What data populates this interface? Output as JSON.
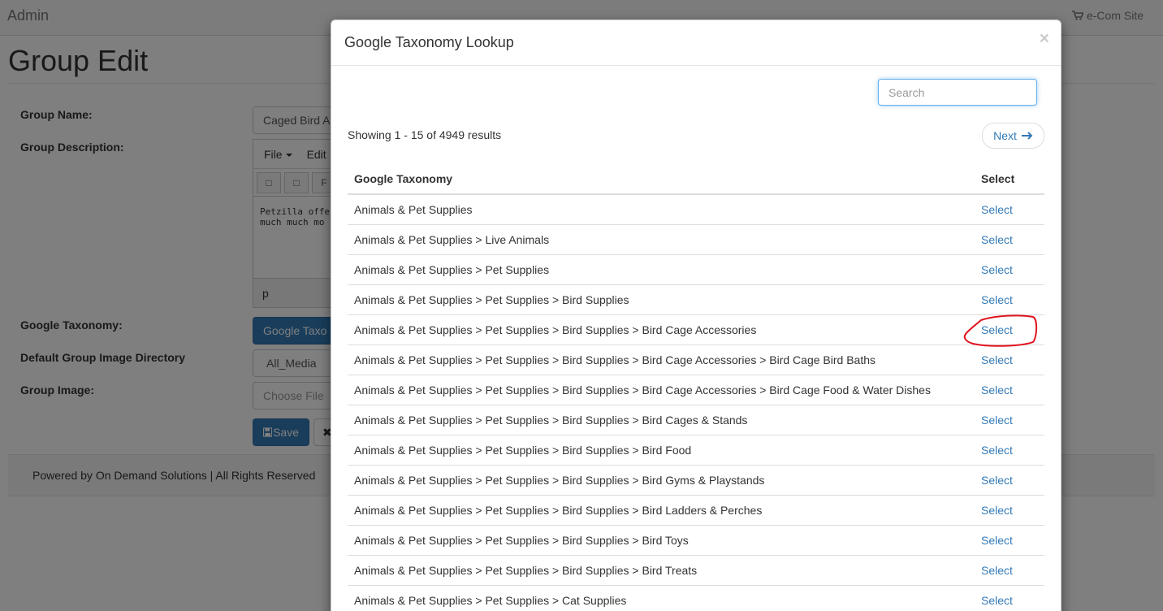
{
  "navbar": {
    "brand": "Admin",
    "ecom_link": "e-Com Site",
    "ecom_icon": "shopping-cart-icon"
  },
  "page": {
    "title": "Group Edit"
  },
  "form": {
    "group_name_label": "Group Name:",
    "group_name_value": "Caged Bird A",
    "group_description_label": "Group Description:",
    "editor": {
      "menu_file": "File",
      "menu_edit": "Edit",
      "toolbar_partial": "F",
      "body_text": "Petzilla offers a\nmuch much mo",
      "status_path": "p"
    },
    "google_taxonomy_label": "Google Taxonomy:",
    "google_taxonomy_button": "Google Taxo",
    "default_image_dir_label": "Default Group Image Directory",
    "default_image_dir_value": "All_Media",
    "group_image_label": "Group Image:",
    "choose_file_label": "Choose File",
    "save_label": "Save",
    "cancel_partial": "✖"
  },
  "footer": {
    "text": "Powered by On Demand Solutions | All Rights Reserved"
  },
  "modal": {
    "title": "Google Taxonomy Lookup",
    "close_symbol": "×",
    "search_placeholder": "Search",
    "results_text": "Showing 1 - 15 of 4949 results",
    "next_label": "Next",
    "table": {
      "col_taxonomy": "Google Taxonomy",
      "col_select": "Select",
      "rows": [
        {
          "taxonomy": "Animals & Pet Supplies",
          "action": "Select"
        },
        {
          "taxonomy": "Animals & Pet Supplies > Live Animals",
          "action": "Select"
        },
        {
          "taxonomy": "Animals & Pet Supplies > Pet Supplies",
          "action": "Select"
        },
        {
          "taxonomy": "Animals & Pet Supplies > Pet Supplies > Bird Supplies",
          "action": "Select"
        },
        {
          "taxonomy": "Animals & Pet Supplies > Pet Supplies > Bird Supplies > Bird Cage Accessories",
          "action": "Select",
          "circled": true
        },
        {
          "taxonomy": "Animals & Pet Supplies > Pet Supplies > Bird Supplies > Bird Cage Accessories > Bird Cage Bird Baths",
          "action": "Select"
        },
        {
          "taxonomy": "Animals & Pet Supplies > Pet Supplies > Bird Supplies > Bird Cage Accessories > Bird Cage Food & Water Dishes",
          "action": "Select"
        },
        {
          "taxonomy": "Animals & Pet Supplies > Pet Supplies > Bird Supplies > Bird Cages & Stands",
          "action": "Select"
        },
        {
          "taxonomy": "Animals & Pet Supplies > Pet Supplies > Bird Supplies > Bird Food",
          "action": "Select"
        },
        {
          "taxonomy": "Animals & Pet Supplies > Pet Supplies > Bird Supplies > Bird Gyms & Playstands",
          "action": "Select"
        },
        {
          "taxonomy": "Animals & Pet Supplies > Pet Supplies > Bird Supplies > Bird Ladders & Perches",
          "action": "Select"
        },
        {
          "taxonomy": "Animals & Pet Supplies > Pet Supplies > Bird Supplies > Bird Toys",
          "action": "Select"
        },
        {
          "taxonomy": "Animals & Pet Supplies > Pet Supplies > Bird Supplies > Bird Treats",
          "action": "Select"
        },
        {
          "taxonomy": "Animals & Pet Supplies > Pet Supplies > Cat Supplies",
          "action": "Select"
        }
      ]
    }
  },
  "colors": {
    "link": "#337ab7",
    "annotation": "#e0141e",
    "primary_button": "#337ab7"
  }
}
